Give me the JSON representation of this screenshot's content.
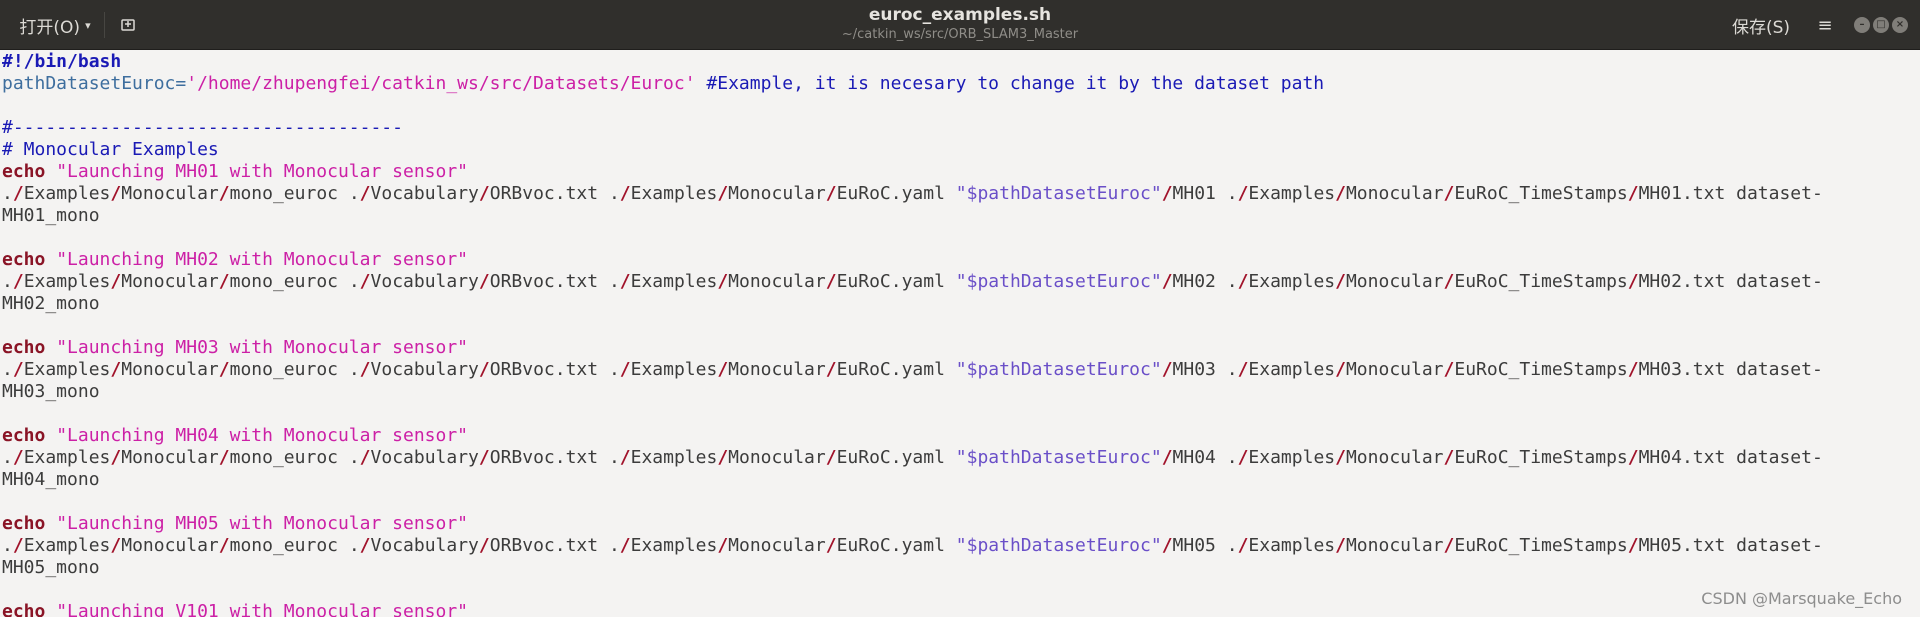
{
  "window": {
    "title": "euroc_examples.sh",
    "subtitle": "~/catkin_ws/src/ORB_SLAM3_Master",
    "open_label": "打开(O)",
    "save_label": "保存(S)",
    "menu_icon": "hamburger-menu-icon",
    "new_tab_icon": "new-document-icon"
  },
  "colors": {
    "headerbar": "#302f2c",
    "editor_bg": "#f4f3f2",
    "comment": "#1a1ab5",
    "string": "#cc20a6",
    "keyword": "#8a1426",
    "slash": "#a1132b",
    "expansion": "#6a4fc8"
  },
  "code": {
    "shebang": "#!/bin/bash",
    "assign_var": "pathDatasetEuroc=",
    "assign_value": "'/home/zhupengfei/catkin_ws/src/Datasets/Euroc'",
    "assign_comment": " #Example, it is necesary to change it by the dataset path",
    "rule_comment": "#------------------------------------",
    "section_comment": "# Monocular Examples",
    "echo_kw": "echo",
    "path_prefix": "./Examples/Monocular/mono_euroc ./Vocabulary/ORBvoc.txt ./Examples/Monocular/EuRoC.yaml",
    "dataset_var": "\"$pathDatasetEuroc\"",
    "timestamps_dir": "./Examples/Monocular/EuRoC_TimeStamps/",
    "blocks": [
      {
        "echo": "\"Launching MH01 with Monocular sensor\"",
        "seq": "/MH01",
        "ts": "MH01.txt dataset-",
        "wrap": "MH01_mono"
      },
      {
        "echo": "\"Launching MH02 with Monocular sensor\"",
        "seq": "/MH02",
        "ts": "MH02.txt dataset-",
        "wrap": "MH02_mono"
      },
      {
        "echo": "\"Launching MH03 with Monocular sensor\"",
        "seq": "/MH03",
        "ts": "MH03.txt dataset-",
        "wrap": "MH03_mono"
      },
      {
        "echo": "\"Launching MH04 with Monocular sensor\"",
        "seq": "/MH04",
        "ts": "MH04.txt dataset-",
        "wrap": "MH04_mono"
      },
      {
        "echo": "\"Launching MH05 with Monocular sensor\"",
        "seq": "/MH05",
        "ts": "MH05.txt dataset-",
        "wrap": "MH05_mono"
      }
    ],
    "last_echo": "\"Launching V101 with Monocular sensor\""
  },
  "watermark": "CSDN @Marsquake_Echo"
}
